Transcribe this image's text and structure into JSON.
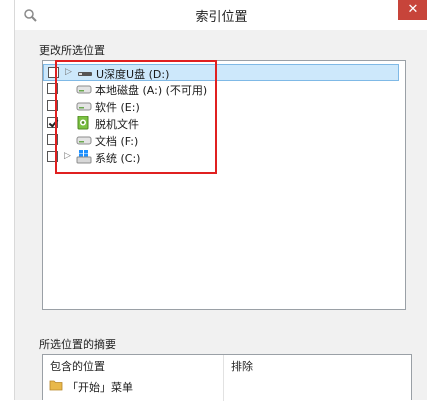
{
  "window": {
    "title": "索引位置",
    "close_glyph": "✕"
  },
  "change_group": {
    "label": "更改所选位置"
  },
  "tree": {
    "items": [
      {
        "label": "U深度U盘 (D:)",
        "checked": false,
        "expander": "▷",
        "icon": "usb-drive-icon"
      },
      {
        "label": "本地磁盘 (A:) (不可用)",
        "checked": false,
        "expander": "",
        "icon": "drive-icon"
      },
      {
        "label": "软件 (E:)",
        "checked": false,
        "expander": "",
        "icon": "drive-icon"
      },
      {
        "label": "脱机文件",
        "checked": true,
        "expander": "",
        "icon": "offline-files-icon"
      },
      {
        "label": "文档 (F:)",
        "checked": false,
        "expander": "",
        "icon": "drive-icon"
      },
      {
        "label": "系统 (C:)",
        "checked": false,
        "expander": "▷",
        "icon": "system-drive-icon"
      }
    ]
  },
  "summary_group": {
    "label": "所选位置的摘要",
    "columns": {
      "included": "包含的位置",
      "excluded": "排除"
    },
    "rows": [
      {
        "label": "「开始」菜单",
        "icon": "folder-icon"
      }
    ]
  },
  "colors": {
    "accent": "#cde8fb",
    "close": "#c7443a",
    "highlight": "#e02020"
  }
}
